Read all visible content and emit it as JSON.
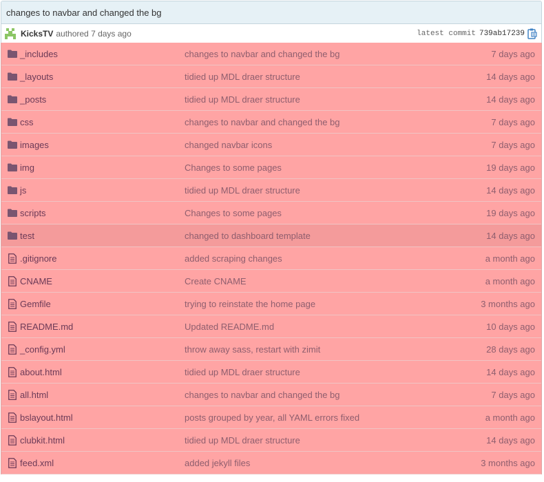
{
  "commit": {
    "message": "changes to navbar and changed the bg",
    "author": "KicksTV",
    "authored_text": "authored 7 days ago",
    "latest_label": "latest commit",
    "sha": "739ab17239"
  },
  "files": [
    {
      "type": "folder",
      "name": "_includes",
      "message": "changes to navbar and changed the bg",
      "age": "7 days ago"
    },
    {
      "type": "folder",
      "name": "_layouts",
      "message": "tidied up MDL draer structure",
      "age": "14 days ago"
    },
    {
      "type": "folder",
      "name": "_posts",
      "message": "tidied up MDL draer structure",
      "age": "14 days ago"
    },
    {
      "type": "folder",
      "name": "css",
      "message": "changes to navbar and changed the bg",
      "age": "7 days ago"
    },
    {
      "type": "folder",
      "name": "images",
      "message": "changed navbar icons",
      "age": "7 days ago"
    },
    {
      "type": "folder",
      "name": "img",
      "message": "Changes to some pages",
      "age": "19 days ago"
    },
    {
      "type": "folder",
      "name": "js",
      "message": "tidied up MDL draer structure",
      "age": "14 days ago"
    },
    {
      "type": "folder",
      "name": "scripts",
      "message": "Changes to some pages",
      "age": "19 days ago"
    },
    {
      "type": "folder",
      "name": "test",
      "message": "changed to dashboard template",
      "age": "14 days ago"
    },
    {
      "type": "file",
      "name": ".gitignore",
      "message": "added scraping changes",
      "age": "a month ago"
    },
    {
      "type": "file",
      "name": "CNAME",
      "message": "Create CNAME",
      "age": "a month ago"
    },
    {
      "type": "file",
      "name": "Gemfile",
      "message": "trying to reinstate the home page",
      "age": "3 months ago"
    },
    {
      "type": "file",
      "name": "README.md",
      "message": "Updated README.md",
      "age": "10 days ago"
    },
    {
      "type": "file",
      "name": "_config.yml",
      "message": "throw away sass, restart with zimit",
      "age": "28 days ago"
    },
    {
      "type": "file",
      "name": "about.html",
      "message": "tidied up MDL draer structure",
      "age": "14 days ago"
    },
    {
      "type": "file",
      "name": "all.html",
      "message": "changes to navbar and changed the bg",
      "age": "7 days ago"
    },
    {
      "type": "file",
      "name": "bslayout.html",
      "message": "posts grouped by year, all YAML errors fixed",
      "age": "a month ago"
    },
    {
      "type": "file",
      "name": "clubkit.html",
      "message": "tidied up MDL draer structure",
      "age": "14 days ago"
    },
    {
      "type": "file",
      "name": "feed.xml",
      "message": "added jekyll files",
      "age": "3 months ago"
    }
  ],
  "hovered_row": "test",
  "colors": {
    "row_bg": "#ffa4a4",
    "row_hover_bg": "#f49b9b",
    "header_bg": "#e6f1f6",
    "link": "#6b3a57"
  }
}
